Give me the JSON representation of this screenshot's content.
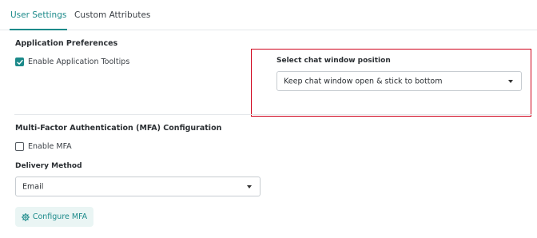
{
  "tabs": [
    {
      "label": "User Settings",
      "active": true
    },
    {
      "label": "Custom Attributes",
      "active": false
    }
  ],
  "app_prefs": {
    "title": "Application Preferences",
    "tooltips_label": "Enable Application Tooltips",
    "tooltips_checked": true
  },
  "chat": {
    "label": "Select chat window position",
    "selected": "Keep chat window open & stick to bottom"
  },
  "mfa": {
    "title": "Multi-Factor Authentication (MFA) Configuration",
    "enable_label": "Enable MFA",
    "enable_checked": false,
    "delivery_label": "Delivery Method",
    "delivery_selected": "Email",
    "configure_label": "Configure MFA"
  },
  "icons": {
    "checkmark": "checkmark-icon",
    "caret": "chevron-down-icon",
    "gear": "gear-icon"
  },
  "colors": {
    "accent": "#1c8a8a",
    "highlight": "#d0021b",
    "button_bg": "#eaf5f4"
  }
}
